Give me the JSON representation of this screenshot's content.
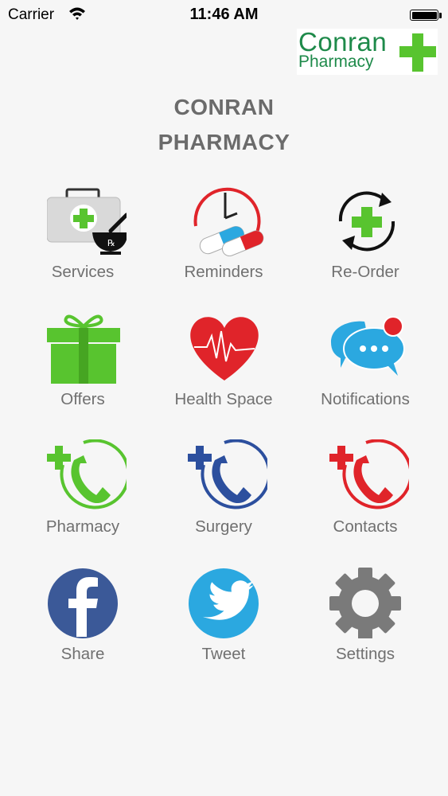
{
  "status_bar": {
    "carrier": "Carrier",
    "time": "11:46 AM"
  },
  "logo": {
    "line1": "Conran",
    "line2": "Pharmacy"
  },
  "title": {
    "line1": "CONRAN",
    "line2": "PHARMACY"
  },
  "menu": [
    {
      "label": "Services",
      "icon": "first-aid-kit-icon"
    },
    {
      "label": "Reminders",
      "icon": "clock-pills-icon"
    },
    {
      "label": "Re-Order",
      "icon": "reorder-cycle-icon"
    },
    {
      "label": "Offers",
      "icon": "gift-icon"
    },
    {
      "label": "Health Space",
      "icon": "heart-heartbeat-icon"
    },
    {
      "label": "Notifications",
      "icon": "chat-bubbles-icon"
    },
    {
      "label": "Pharmacy",
      "icon": "pharmacy-phone-icon"
    },
    {
      "label": "Surgery",
      "icon": "surgery-phone-icon"
    },
    {
      "label": "Contacts",
      "icon": "contacts-phone-icon"
    },
    {
      "label": "Share",
      "icon": "facebook-icon"
    },
    {
      "label": "Tweet",
      "icon": "twitter-icon"
    },
    {
      "label": "Settings",
      "icon": "gear-icon"
    }
  ],
  "colors": {
    "green": "#58c42f",
    "red": "#e0242a",
    "blue": "#2c4f9e",
    "facebook": "#3b5998",
    "twitter": "#2ba8e0",
    "gear": "#7a7a7a",
    "label": "#707070",
    "title": "#6b6b6b"
  }
}
